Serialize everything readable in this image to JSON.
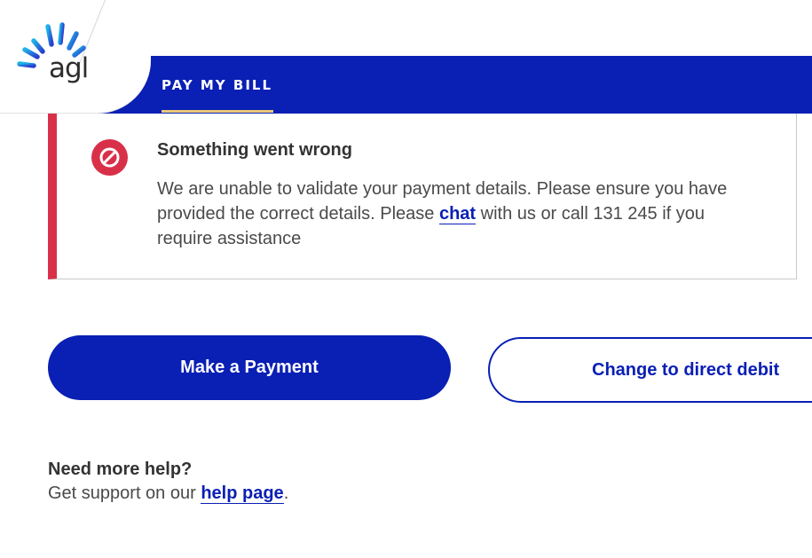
{
  "brand": {
    "logo_text": "agl",
    "color": "#0a1fb4"
  },
  "nav": {
    "tab_label": "PAY MY BILL",
    "underline_color": "#e9c97a"
  },
  "alert": {
    "title": "Something went wrong",
    "body_before_link": "We are unable to validate your payment details. Please ensure you have provided the correct details. Please ",
    "link_text": "chat",
    "body_after_link": " with us or call 131 245 if you require assistance",
    "accent_color": "#d9304a",
    "icon": "prohibited-icon"
  },
  "actions": {
    "primary_label": "Make a Payment",
    "secondary_label": "Change to direct debit"
  },
  "help": {
    "title": "Need more help?",
    "text_before_link": "Get support on our ",
    "link_text": "help page",
    "text_after_link": "."
  }
}
